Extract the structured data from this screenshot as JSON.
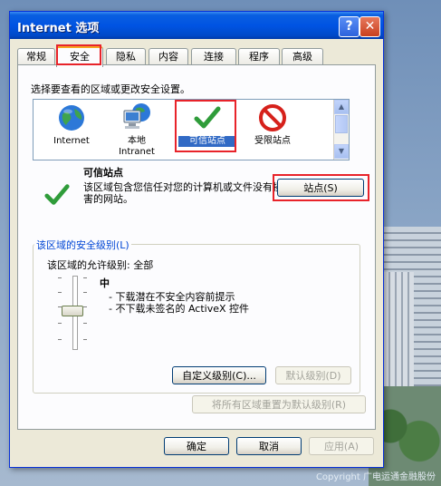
{
  "dialog": {
    "title": "Internet 选项",
    "help_icon": "?",
    "close_icon": "✕"
  },
  "tabs": [
    {
      "label": "常规"
    },
    {
      "label": "安全"
    },
    {
      "label": "隐私"
    },
    {
      "label": "内容"
    },
    {
      "label": "连接"
    },
    {
      "label": "程序"
    },
    {
      "label": "高级"
    }
  ],
  "security": {
    "prompt": "选择要查看的区域或更改安全设置。",
    "zones": [
      {
        "label": "Internet",
        "icon": "globe-icon"
      },
      {
        "label": "本地\nIntranet",
        "icon": "computer-network-icon"
      },
      {
        "label": "可信站点",
        "icon": "checkmark-icon",
        "selected": true
      },
      {
        "label": "受限站点",
        "icon": "restricted-icon"
      }
    ],
    "zone_title": "可信站点",
    "zone_description": "该区域包含您信任对您的计算机或文件没有损害的网站。",
    "sites_button": "站点(S)",
    "level_group_label": "该区域的安全级别(L)",
    "allowed_levels": "该区域的允许级别: 全部",
    "level_name": "中",
    "level_bullets": [
      "- 下载潜在不安全内容前提示",
      "- 不下载未签名的 ActiveX 控件"
    ],
    "custom_level_button": "自定义级别(C)...",
    "default_level_button": "默认级别(D)",
    "reset_all_button": "将所有区域重置为默认级别(R)"
  },
  "footer": {
    "ok": "确定",
    "cancel": "取消",
    "apply": "应用(A)"
  },
  "background": {
    "copyright": "Copyright 广电运通金融股份"
  },
  "colors": {
    "highlight": "#e8232a",
    "titlebar": "#0054e3",
    "selection": "#316ac5"
  }
}
